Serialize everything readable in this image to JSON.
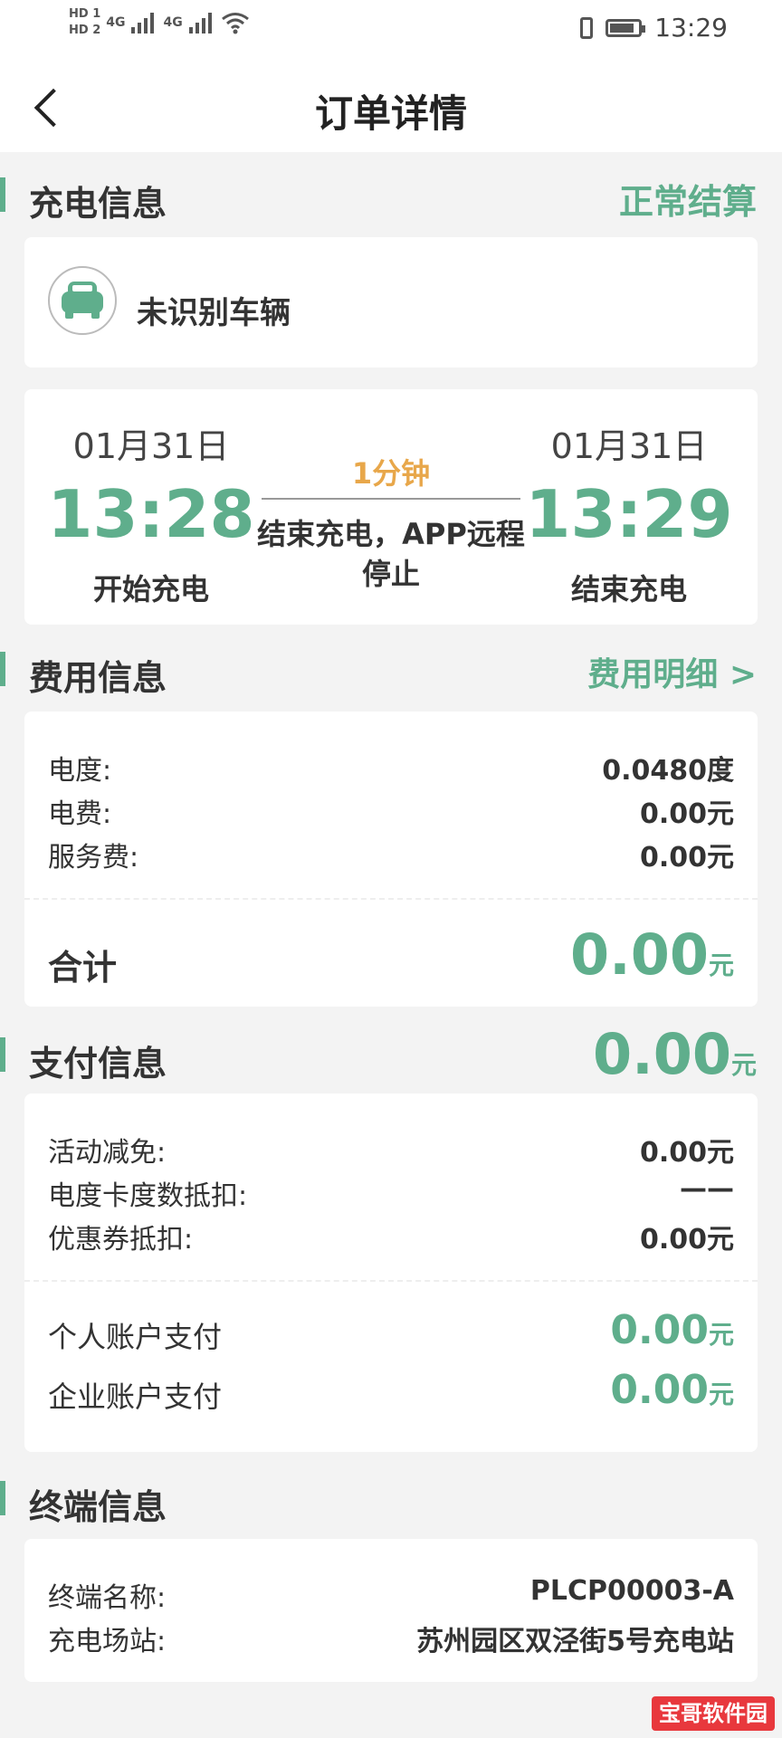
{
  "status_bar": {
    "hd1": "HD 1",
    "hd2": "HD 2",
    "net1": "4G",
    "net2": "4G",
    "battery_level": 0.85,
    "time": "13:29"
  },
  "header": {
    "title": "订单详情"
  },
  "charge_info": {
    "section_title": "充电信息",
    "status": "正常结算",
    "vehicle": "未识别车辆",
    "start_date": "01月31日",
    "start_time": "13:28",
    "start_label": "开始充电",
    "duration": "1分钟",
    "end_reason": "结束充电，APP远程停止",
    "end_date": "01月31日",
    "end_time": "13:29",
    "end_label": "结束充电"
  },
  "fee_info": {
    "section_title": "费用信息",
    "detail_link": "费用明细 >",
    "rows": [
      {
        "label": "电度:",
        "value": "0.0480度"
      },
      {
        "label": "电费:",
        "value": "0.00元"
      },
      {
        "label": "服务费:",
        "value": "0.00元"
      }
    ],
    "total_label": "合计",
    "total_value": "0.00",
    "total_unit": "元"
  },
  "payment_info": {
    "section_title": "支付信息",
    "amount": "0.00",
    "unit": "元",
    "rows": [
      {
        "label": "活动减免:",
        "value": "0.00元"
      },
      {
        "label": "电度卡度数抵扣:",
        "value": "——"
      },
      {
        "label": "优惠券抵扣:",
        "value": "0.00元"
      }
    ],
    "personal_label": "个人账户支付",
    "personal_value": "0.00",
    "enterprise_label": "企业账户支付",
    "enterprise_value": "0.00"
  },
  "terminal_info": {
    "section_title": "终端信息",
    "rows": [
      {
        "label": "终端名称:",
        "value": "PLCP00003-A"
      },
      {
        "label": "充电场站:",
        "value": "苏州园区双泾街5号充电站"
      }
    ]
  },
  "watermark": "宝哥软件园",
  "colors": {
    "accent": "#5fae8c",
    "duration": "#e8a74a",
    "background": "#f3f3f3"
  },
  "icons": [
    "back-chevron-icon",
    "car-icon",
    "battery-icon",
    "vibrate-icon",
    "wifi-icon",
    "signal-icon"
  ]
}
